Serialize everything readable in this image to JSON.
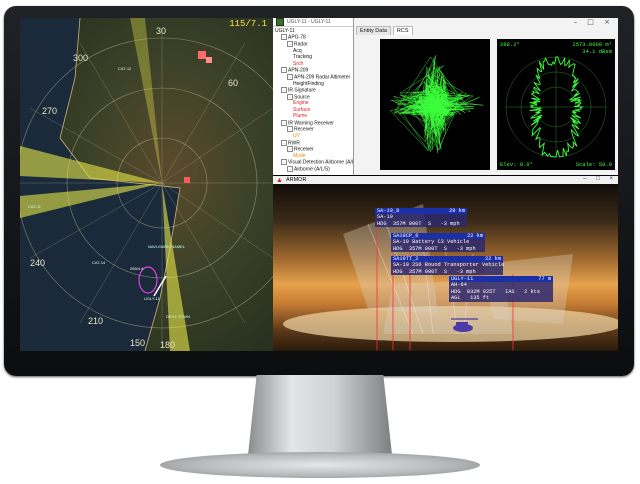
{
  "map": {
    "status_readout": "115/7.1",
    "compass": [
      "30",
      "60",
      "300",
      "270",
      "240",
      "210",
      "180",
      "150"
    ],
    "places": [
      "CAT-12",
      "CAT-11",
      "CAT-14",
      "NAVI-MARK-NAMEL",
      "DEVT-TOWN",
      "UGLY-11",
      "265/4.4"
    ]
  },
  "tree": {
    "window_title": "UGLY-11 - UGLY-11",
    "items": [
      {
        "text": "UGLY-11",
        "color": "normal",
        "exp": ""
      },
      {
        "text": "APG-78",
        "color": "normal",
        "exp": "-"
      },
      {
        "text": "Radar",
        "color": "normal",
        "exp": "-"
      },
      {
        "text": "Acq",
        "color": "normal",
        "exp": ""
      },
      {
        "text": "Tracking",
        "color": "normal",
        "exp": ""
      },
      {
        "text": "Srch",
        "color": "red",
        "exp": ""
      },
      {
        "text": "APN-209",
        "color": "normal",
        "exp": "-"
      },
      {
        "text": "APN-209 Radar Altimeter",
        "color": "normal",
        "exp": "-"
      },
      {
        "text": "HeightFinding",
        "color": "normal",
        "exp": ""
      },
      {
        "text": "IR Signature",
        "color": "normal",
        "exp": "-"
      },
      {
        "text": "Source",
        "color": "normal",
        "exp": "-"
      },
      {
        "text": "Engine",
        "color": "red",
        "exp": ""
      },
      {
        "text": "Surface",
        "color": "red",
        "exp": ""
      },
      {
        "text": "Plume",
        "color": "red",
        "exp": ""
      },
      {
        "text": "IR Warning Receiver",
        "color": "normal",
        "exp": "-"
      },
      {
        "text": "Receiver",
        "color": "normal",
        "exp": "-"
      },
      {
        "text": "UV",
        "color": "orange",
        "exp": ""
      },
      {
        "text": "RWR",
        "color": "normal",
        "exp": "-"
      },
      {
        "text": "Receiver",
        "color": "normal",
        "exp": "-"
      },
      {
        "text": "Mode",
        "color": "orange",
        "exp": ""
      },
      {
        "text": "Visual Detection Airborne (A/L/S)",
        "color": "normal",
        "exp": "-"
      },
      {
        "text": "Airborne (A/L/S)",
        "color": "normal",
        "exp": "-"
      }
    ]
  },
  "data_pane": {
    "tabs": [
      "Entity Data",
      "RCS"
    ],
    "active_tab": "RCS",
    "rcs_top_left": "288.2°",
    "rcs_top_right_1": "2573.0000 m²",
    "rcs_top_right_2": "34.1 dBsm",
    "rcs_bottom_left": "Elev: 0.0°",
    "rcs_bottom_right": "Scale: 50.0"
  },
  "armor": {
    "title": "ARMOR",
    "tags": [
      {
        "header": "SA-19_8",
        "range": "29 km",
        "rows": [
          "SA-19",
          "HDG  357M 000T  S   -3 mph"
        ]
      },
      {
        "header": "SA19CP_6",
        "range": "22 km",
        "rows": [
          "SA-19 Battery C3 Vehicle",
          "HDG  357M 000T  S   -3 mph"
        ]
      },
      {
        "header": "SA19TT_2",
        "range": "22 km",
        "rows": [
          "SA-19 2S6 Round Transporter Vehicle",
          "HDG  357M 000T  S   -3 mph"
        ]
      },
      {
        "header": "UGLY-11",
        "range": "77 m",
        "rows": [
          "AH-64",
          "HDG  032M 025T   IAS   2 kts",
          "AGL   135 ft"
        ]
      }
    ]
  },
  "colors": {
    "map_sector": "#e8e84a",
    "rcs_green": "#3cff3c",
    "tag_header": "#1b2fa8",
    "red_item": "#e02020",
    "orange_item": "#e58a12"
  }
}
